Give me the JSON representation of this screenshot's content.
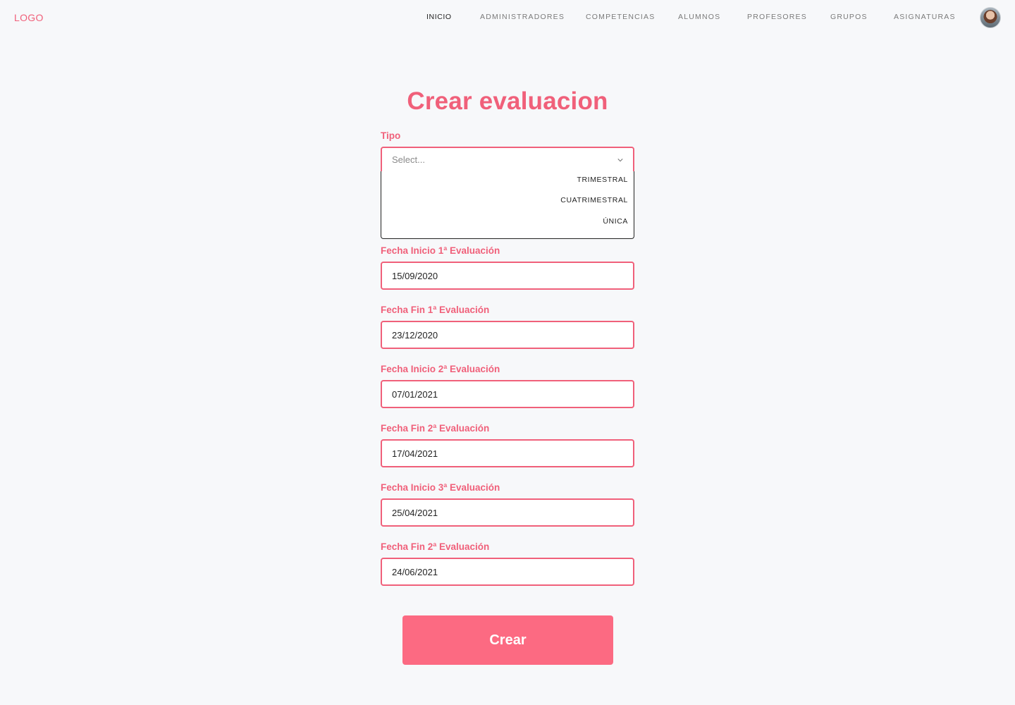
{
  "header": {
    "logo": "LOGO",
    "nav": [
      {
        "label": "INICIO",
        "active": true
      },
      {
        "label": "ADMINISTRADORES",
        "active": false
      },
      {
        "label": "COMPETENCIAS",
        "active": false
      },
      {
        "label": "ALUMNOS",
        "active": false
      },
      {
        "label": "PROFESORES",
        "active": false
      },
      {
        "label": "GRUPOS",
        "active": false
      },
      {
        "label": "ASIGNATURAS",
        "active": false
      }
    ],
    "avatar_icon": "user-avatar-icon"
  },
  "form": {
    "title": "Crear evaluacion",
    "tipo": {
      "label": "Tipo",
      "placeholder": "Select...",
      "options": [
        "TRIMESTRAL",
        "CUATRIMESTRAL",
        "ÚNICA"
      ]
    },
    "fields": [
      {
        "label": "Fecha Inicio 1ª Evaluación",
        "value": "15/09/2020"
      },
      {
        "label": "Fecha Fin 1ª Evaluación",
        "value": "23/12/2020"
      },
      {
        "label": "Fecha Inicio 2ª Evaluación",
        "value": "07/01/2021"
      },
      {
        "label": "Fecha Fin 2ª Evaluación",
        "value": "17/04/2021"
      },
      {
        "label": "Fecha Inicio 3ª Evaluación",
        "value": "25/04/2021"
      },
      {
        "label": "Fecha Fin 2ª Evaluación",
        "value": "24/06/2021"
      }
    ],
    "submit_label": "Crear"
  },
  "colors": {
    "accent": "#f0607a",
    "button": "#fc6a82",
    "background": "#f7f8fa"
  }
}
